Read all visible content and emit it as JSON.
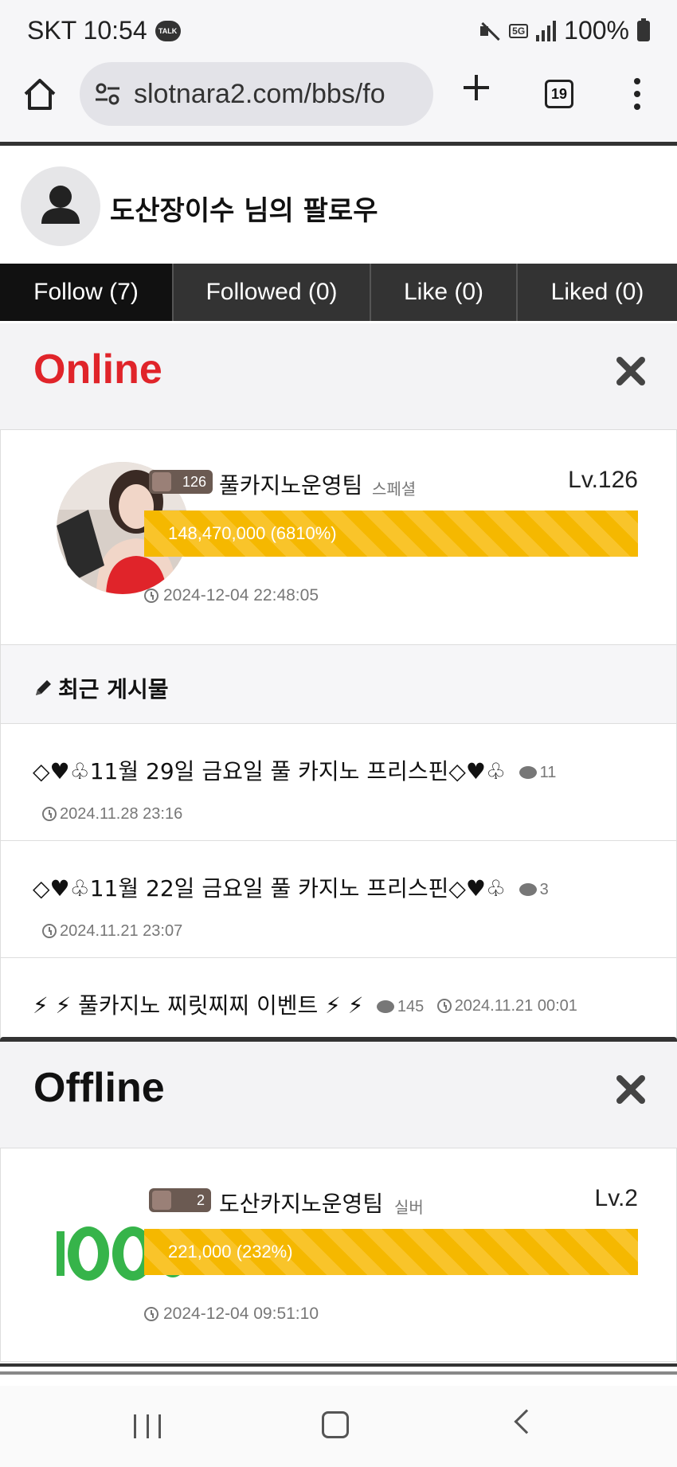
{
  "status_bar": {
    "carrier_time": "SKT 10:54",
    "talk_badge": "TALK",
    "network": "5G",
    "battery": "100%"
  },
  "browser": {
    "url": "slotnara2.com/bbs/fo",
    "tab_count": "19"
  },
  "header": {
    "title": "도산장이수 님의 팔로우"
  },
  "tabs": [
    {
      "label": "Follow (7)",
      "active": true
    },
    {
      "label": "Followed (0)",
      "active": false
    },
    {
      "label": "Like (0)",
      "active": false
    },
    {
      "label": "Liked (0)",
      "active": false
    }
  ],
  "online": {
    "title": "Online",
    "title_color": "#e0242a",
    "user": {
      "badge_level": "126",
      "name": "풀카지노운영팀",
      "grade": "스페셜",
      "level": "Lv.126",
      "progress_text": "148,470,000 (6810%)",
      "progress_percent": 100,
      "time": "2024-12-04 22:48:05"
    },
    "recent_title": "최근 게시물",
    "posts": [
      {
        "title": "◇♥♧11월 29일 금요일 풀 카지노 프리스핀◇♥♧",
        "comments": "11",
        "date": "2024.11.28 23:16"
      },
      {
        "title": "◇♥♧11월 22일 금요일 풀 카지노 프리스핀◇♥♧",
        "comments": "3",
        "date": "2024.11.21 23:07"
      },
      {
        "title": "⚡ ⚡ 풀카지노 찌릿찌찌 이벤트 ⚡ ⚡",
        "comments": "145",
        "date": "2024.11.21 00:01"
      }
    ]
  },
  "offline": {
    "title": "Offline",
    "user": {
      "badge_level": "2",
      "name": "도산카지노운영팀",
      "grade": "실버",
      "level": "Lv.2",
      "progress_text": "221,000 (232%)",
      "progress_percent": 100,
      "time": "2024-12-04 09:51:10"
    }
  },
  "accent_color": "#f5b800"
}
